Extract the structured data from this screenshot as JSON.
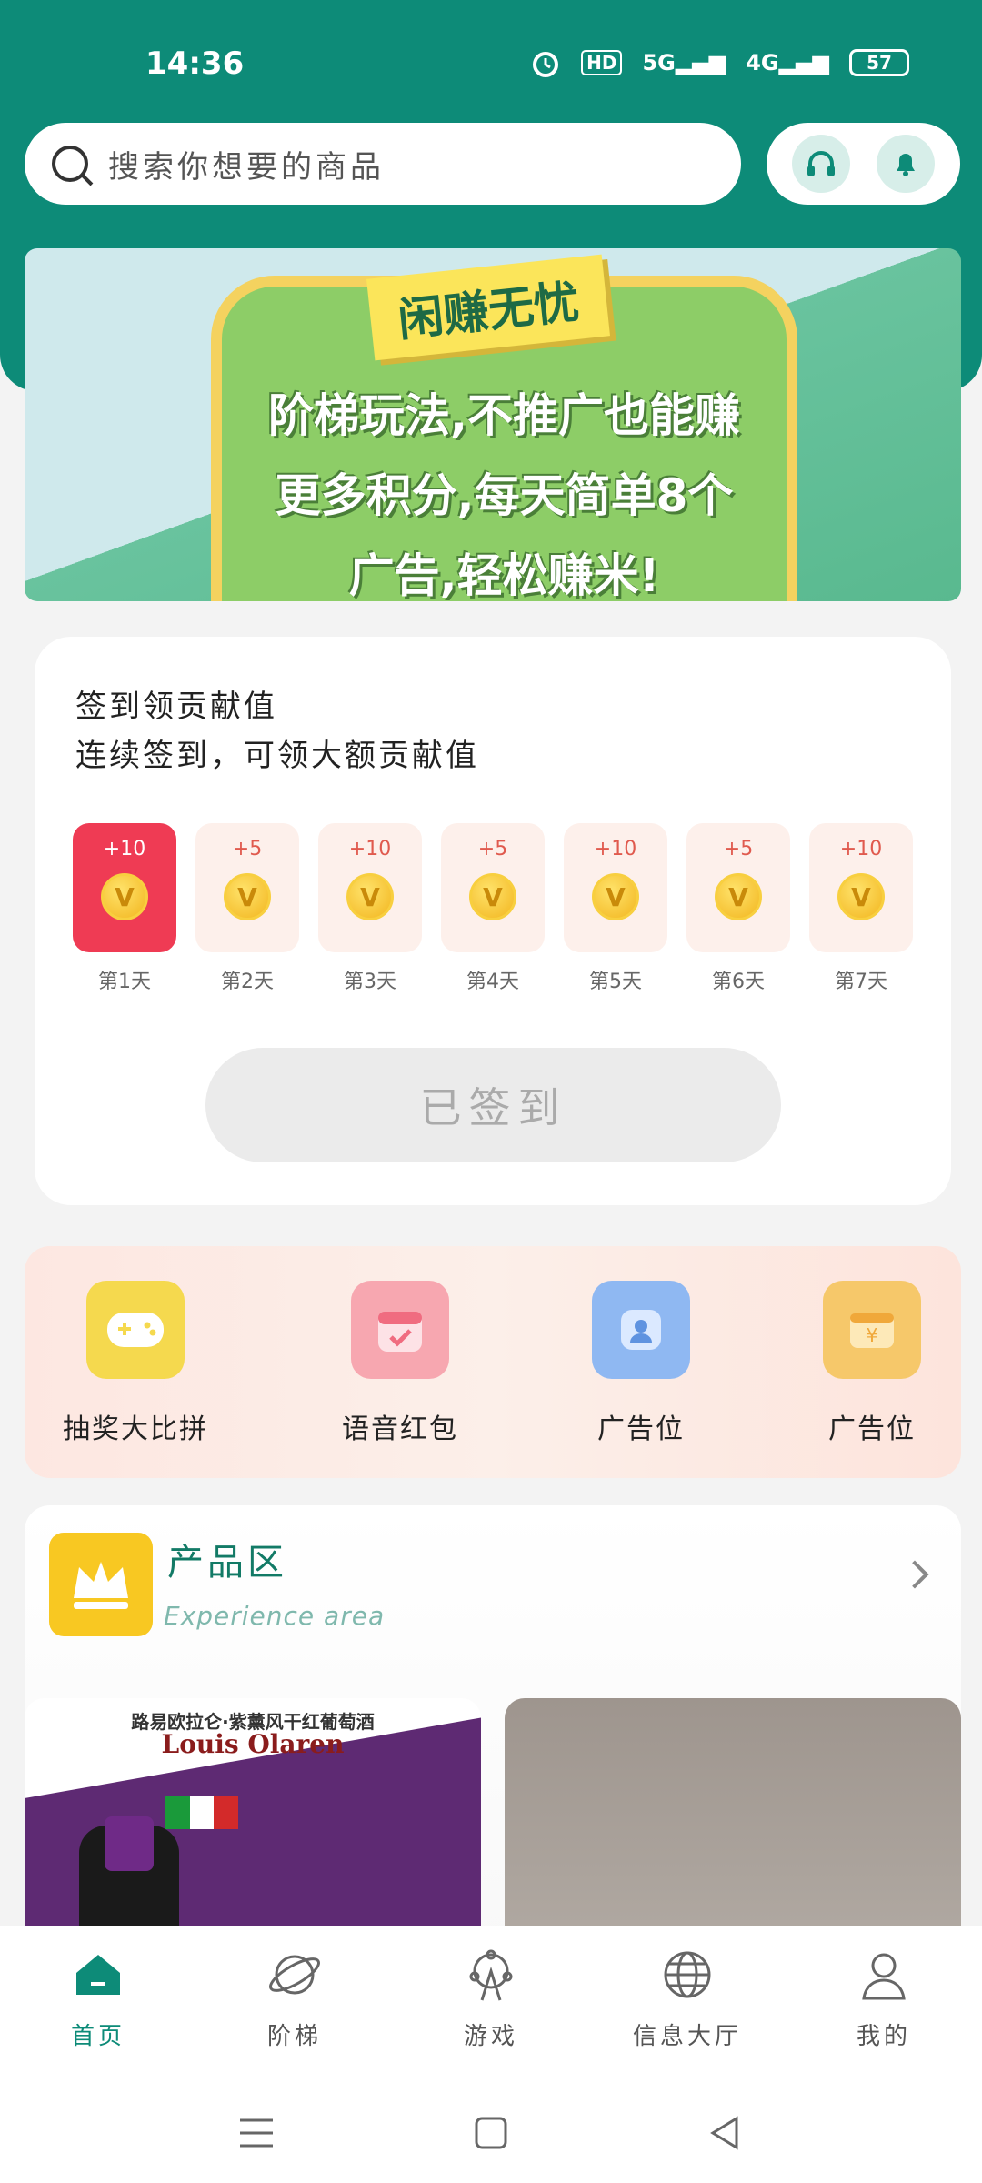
{
  "status": {
    "time": "14:36",
    "hd": "HD",
    "net1": "5G",
    "net2": "4G",
    "battery": "57"
  },
  "search": {
    "placeholder": "搜索你想要的商品"
  },
  "banner": {
    "tag": "闲赚无忧",
    "line1": "阶梯玩法,不推广也能赚",
    "line2": "更多积分,每天简单8个",
    "line3": "广告,轻松赚米!"
  },
  "checkin": {
    "title_line1": "签到领贡献值",
    "title_line2": "连续签到，可领大额贡献值",
    "days": [
      {
        "points": "+10",
        "label": "第1天",
        "active": true
      },
      {
        "points": "+5",
        "label": "第2天"
      },
      {
        "points": "+10",
        "label": "第3天"
      },
      {
        "points": "+5",
        "label": "第4天"
      },
      {
        "points": "+10",
        "label": "第5天"
      },
      {
        "points": "+5",
        "label": "第6天"
      },
      {
        "points": "+10",
        "label": "第7天"
      }
    ],
    "button_label": "已签到"
  },
  "quick": [
    {
      "label": "抽奖大比拼",
      "icon": "gamepad-icon",
      "color": "#f5d94e"
    },
    {
      "label": "语音红包",
      "icon": "calendar-icon",
      "color": "#f7a7b0"
    },
    {
      "label": "广告位",
      "icon": "profile-card-icon",
      "color": "#8fb8f2"
    },
    {
      "label": "广告位",
      "icon": "wallet-icon",
      "color": "#f6c86a"
    }
  ],
  "product": {
    "title": "产品区",
    "subtitle": "Experience area",
    "wine_heading": "路易欧拉仑·紫薰风干红葡萄酒",
    "wine_brand": "Louis Olaren"
  },
  "nav": [
    {
      "label": "首页",
      "icon": "home-icon",
      "active": true
    },
    {
      "label": "阶梯",
      "icon": "planet-icon"
    },
    {
      "label": "游戏",
      "icon": "ferris-wheel-icon"
    },
    {
      "label": "信息大厅",
      "icon": "globe-icon"
    },
    {
      "label": "我的",
      "icon": "person-icon"
    }
  ],
  "colors": {
    "primary": "#0d8b78",
    "checkin_active": "#ef3b54",
    "coin": "#f2b51e"
  }
}
